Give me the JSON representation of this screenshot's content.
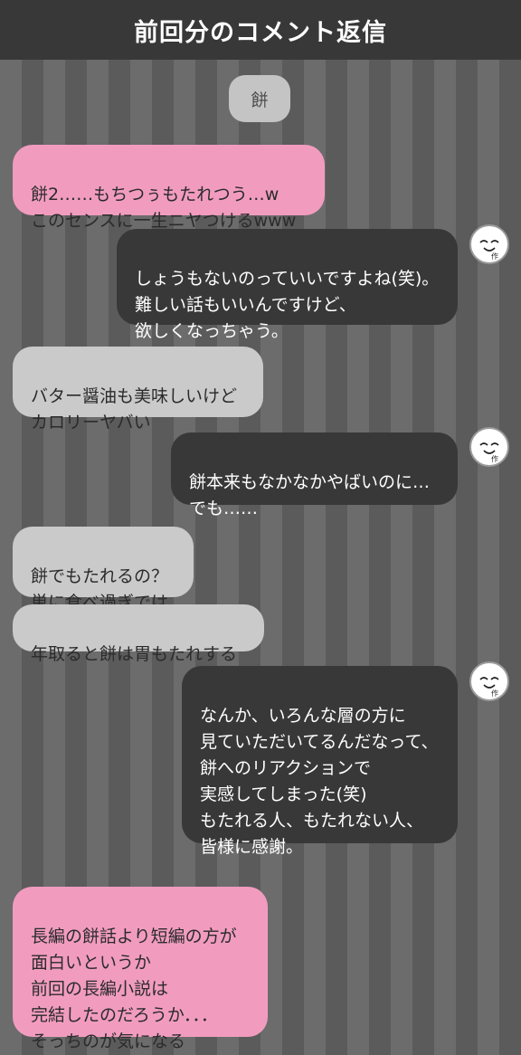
{
  "header": {
    "title": "前回分のコメント返信"
  },
  "topic": {
    "label": "餅"
  },
  "messages": [
    {
      "text": "餅2……もちつぅもたれつう…w\nこのセンスに一生ニヤつけるwww"
    },
    {
      "text": "しょうもないのっていいですよね(笑)。\n難しい話もいいんですけど、\n欲しくなっちゃう。"
    },
    {
      "text": "バター醤油も美味しいけど\nカロリーヤバい"
    },
    {
      "text": "餅本来もなかなかやばいのに…\nでも……"
    },
    {
      "text": "餅でもたれるの？\n単に食べ過ぎでは"
    },
    {
      "text": "年取ると餅は胃もたれする"
    },
    {
      "text": "なんか、いろんな層の方に\n見ていただいてるんだなって、\n餅へのリアクションで\n実感してしまった(笑)\nもたれる人、もたれない人、\n皆様に感謝。"
    },
    {
      "text": "長編の餅話より短編の方が\n面白いというか\n前回の長編小説は\n完結したのだろうか．．．\nそっちのが気になる"
    }
  ],
  "author_avatar": {
    "label": "作",
    "icon": "author-face-icon"
  },
  "colors": {
    "reader_pink": "#f19cbf",
    "reader_grey": "#cacaca",
    "author_dark": "#383838"
  }
}
